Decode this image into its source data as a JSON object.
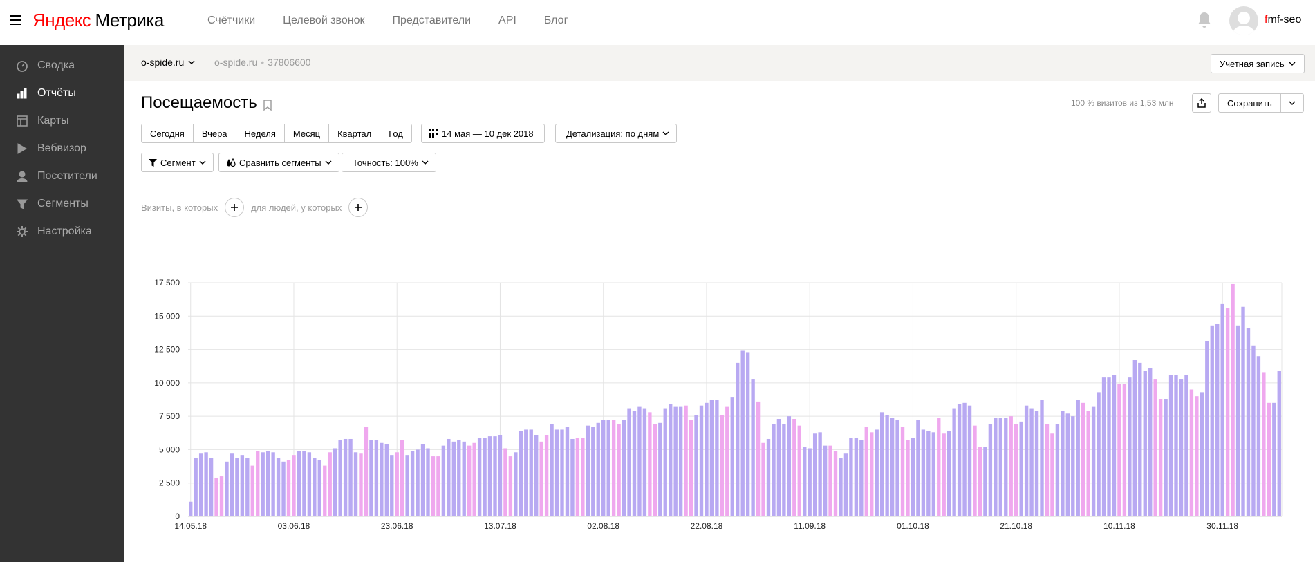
{
  "header": {
    "logo_left": "Яндекс",
    "logo_right": "Метрика",
    "nav": [
      "Счётчики",
      "Целевой звонок",
      "Представители",
      "API",
      "Блог"
    ],
    "user_first": "f",
    "user_rest": "mf-seo"
  },
  "sidebar": {
    "items": [
      {
        "label": "Сводка",
        "icon": "dashboard-icon"
      },
      {
        "label": "Отчёты",
        "icon": "reports-icon"
      },
      {
        "label": "Карты",
        "icon": "maps-icon"
      },
      {
        "label": "Вебвизор",
        "icon": "play-icon"
      },
      {
        "label": "Посетители",
        "icon": "user-icon"
      },
      {
        "label": "Сегменты",
        "icon": "filter-icon"
      },
      {
        "label": "Настройка",
        "icon": "gear-icon"
      }
    ],
    "active_index": 1
  },
  "counter": {
    "selected": "o-spide.ru",
    "name": "o-spide.ru",
    "id": "37806600",
    "account_label": "Учетная запись"
  },
  "report": {
    "title": "Посещаемость",
    "visits_note": "100 % визитов из 1,53 млн",
    "save_label": "Сохранить",
    "periods": [
      "Сегодня",
      "Вчера",
      "Неделя",
      "Месяц",
      "Квартал",
      "Год"
    ],
    "date_range": "14 мая — 10 дек 2018",
    "detail": "Детализация: по дням",
    "segment": "Сегмент",
    "compare": "Сравнить сегменты",
    "accuracy": "Точность: 100%",
    "filter_visits": "Визиты, в которых",
    "filter_people": "для людей, у которых"
  },
  "colors": {
    "weekday": "#b8a9f2",
    "weekend": "#efa8ee",
    "weekend_label": "#cc0000",
    "sidebar_bg": "#333333",
    "counter_bar_bg": "#f4f3f1"
  },
  "chart_data": {
    "type": "bar",
    "title": "",
    "xlabel": "",
    "ylabel": "",
    "ylim": [
      0,
      17500
    ],
    "y_ticks": [
      "0",
      "2 500",
      "5 000",
      "7 500",
      "10 000",
      "12 500",
      "15 000",
      "17 500"
    ],
    "y_tick_values": [
      0,
      2500,
      5000,
      7500,
      10000,
      12500,
      15000,
      17500
    ],
    "x_tick_labels": [
      {
        "label": "14.05.18",
        "index": 0,
        "weekend": false
      },
      {
        "label": "03.06.18",
        "index": 20,
        "weekend": true
      },
      {
        "label": "23.06.18",
        "index": 40,
        "weekend": true
      },
      {
        "label": "13.07.18",
        "index": 60,
        "weekend": false
      },
      {
        "label": "02.08.18",
        "index": 80,
        "weekend": false
      },
      {
        "label": "22.08.18",
        "index": 100,
        "weekend": false
      },
      {
        "label": "11.09.18",
        "index": 120,
        "weekend": false
      },
      {
        "label": "01.10.18",
        "index": 140,
        "weekend": false
      },
      {
        "label": "21.10.18",
        "index": 160,
        "weekend": true
      },
      {
        "label": "10.11.18",
        "index": 180,
        "weekend": true
      },
      {
        "label": "30.11.18",
        "index": 200,
        "weekend": false
      }
    ],
    "grid": true,
    "legend": "none",
    "first_date": "14.05.18",
    "first_weekday": 0,
    "values": [
      1100,
      4400,
      4700,
      4800,
      4400,
      2900,
      3000,
      4100,
      4700,
      4400,
      4600,
      4400,
      3800,
      4900,
      4800,
      4900,
      4800,
      4400,
      4100,
      4200,
      4600,
      4900,
      4900,
      4800,
      4400,
      4200,
      3800,
      4800,
      5100,
      5700,
      5800,
      5800,
      4800,
      4700,
      6700,
      5700,
      5700,
      5500,
      5400,
      4600,
      4800,
      5700,
      4600,
      4900,
      5000,
      5400,
      5100,
      4500,
      4500,
      5300,
      5800,
      5600,
      5700,
      5600,
      5300,
      5500,
      5900,
      5900,
      6000,
      6000,
      6100,
      5100,
      4500,
      4800,
      6400,
      6500,
      6500,
      6100,
      5600,
      6100,
      6900,
      6500,
      6500,
      6700,
      5800,
      5900,
      5900,
      6800,
      6700,
      7000,
      7200,
      7200,
      7200,
      6900,
      7200,
      8100,
      7900,
      8200,
      8100,
      7800,
      6900,
      7000,
      8100,
      8400,
      8200,
      8200,
      8300,
      7200,
      7600,
      8300,
      8500,
      8700,
      8700,
      7600,
      8200,
      8900,
      11500,
      12400,
      12300,
      10300,
      8600,
      5500,
      5800,
      6900,
      7300,
      6900,
      7500,
      7300,
      6800,
      5200,
      5100,
      6200,
      6300,
      5300,
      5300,
      4900,
      4400,
      4700,
      5900,
      5900,
      5700,
      6700,
      6300,
      6500,
      7800,
      7600,
      7400,
      7200,
      6700,
      5700,
      5900,
      7200,
      6500,
      6400,
      6300,
      7400,
      6200,
      6400,
      8100,
      8400,
      8500,
      8300,
      6800,
      5200,
      5200,
      6900,
      7400,
      7400,
      7400,
      7500,
      6900,
      7100,
      8300,
      8100,
      7900,
      8700,
      6900,
      6200,
      6900,
      7900,
      7700,
      7500,
      8700,
      8500,
      7900,
      8200,
      9300,
      10400,
      10400,
      10600,
      9900,
      9900,
      10400,
      11700,
      11500,
      10900,
      11100,
      10300,
      8800,
      8800,
      10600,
      10600,
      10300,
      10600,
      9500,
      9000,
      9300,
      13100,
      14300,
      14400,
      15900,
      15600,
      17400,
      14300,
      15700,
      14100,
      12800,
      12000,
      10800,
      8500,
      8500,
      10900
    ]
  }
}
